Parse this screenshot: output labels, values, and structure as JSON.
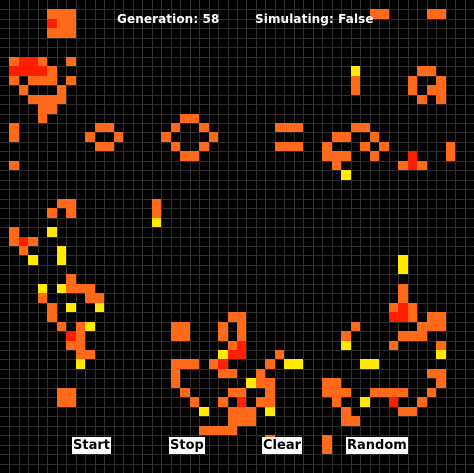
{
  "hud": {
    "generation_label": "Generation: 58",
    "simulating_label": "Simulating: False"
  },
  "controls": {
    "start_label": "Start",
    "stop_label": "Stop",
    "clear_label": "Clear",
    "random_label": "Random"
  },
  "grid": {
    "columns": 50,
    "rows": 50,
    "background_color": "#000000",
    "line_color": "#2e2e2e"
  },
  "colors": {
    "orange": "#ff6a1a",
    "red": "#ff1e00",
    "yellow": "#ffea00"
  },
  "live_cells": [
    {
      "c": 5,
      "r": 1,
      "k": "orange"
    },
    {
      "c": 6,
      "r": 1,
      "k": "orange"
    },
    {
      "c": 7,
      "r": 1,
      "k": "orange"
    },
    {
      "c": 5,
      "r": 2,
      "k": "red"
    },
    {
      "c": 6,
      "r": 2,
      "k": "orange"
    },
    {
      "c": 7,
      "r": 2,
      "k": "orange"
    },
    {
      "c": 5,
      "r": 3,
      "k": "orange"
    },
    {
      "c": 6,
      "r": 3,
      "k": "orange"
    },
    {
      "c": 7,
      "r": 3,
      "k": "orange"
    },
    {
      "c": 39,
      "r": 1,
      "k": "orange"
    },
    {
      "c": 40,
      "r": 1,
      "k": "orange"
    },
    {
      "c": 45,
      "r": 1,
      "k": "orange"
    },
    {
      "c": 46,
      "r": 1,
      "k": "orange"
    },
    {
      "c": 1,
      "r": 6,
      "k": "orange"
    },
    {
      "c": 2,
      "r": 6,
      "k": "red"
    },
    {
      "c": 3,
      "r": 6,
      "k": "red"
    },
    {
      "c": 4,
      "r": 6,
      "k": "orange"
    },
    {
      "c": 7,
      "r": 6,
      "k": "orange"
    },
    {
      "c": 1,
      "r": 7,
      "k": "red"
    },
    {
      "c": 2,
      "r": 7,
      "k": "red"
    },
    {
      "c": 3,
      "r": 7,
      "k": "red"
    },
    {
      "c": 4,
      "r": 7,
      "k": "red"
    },
    {
      "c": 5,
      "r": 7,
      "k": "orange"
    },
    {
      "c": 1,
      "r": 8,
      "k": "orange"
    },
    {
      "c": 3,
      "r": 8,
      "k": "orange"
    },
    {
      "c": 4,
      "r": 8,
      "k": "orange"
    },
    {
      "c": 5,
      "r": 8,
      "k": "orange"
    },
    {
      "c": 7,
      "r": 8,
      "k": "orange"
    },
    {
      "c": 2,
      "r": 9,
      "k": "orange"
    },
    {
      "c": 6,
      "r": 9,
      "k": "orange"
    },
    {
      "c": 3,
      "r": 10,
      "k": "orange"
    },
    {
      "c": 4,
      "r": 10,
      "k": "orange"
    },
    {
      "c": 5,
      "r": 10,
      "k": "orange"
    },
    {
      "c": 6,
      "r": 10,
      "k": "orange"
    },
    {
      "c": 4,
      "r": 11,
      "k": "orange"
    },
    {
      "c": 5,
      "r": 11,
      "k": "orange"
    },
    {
      "c": 4,
      "r": 12,
      "k": "orange"
    },
    {
      "c": 1,
      "r": 13,
      "k": "orange"
    },
    {
      "c": 1,
      "r": 14,
      "k": "orange"
    },
    {
      "c": 37,
      "r": 7,
      "k": "yellow"
    },
    {
      "c": 37,
      "r": 8,
      "k": "orange"
    },
    {
      "c": 37,
      "r": 9,
      "k": "orange"
    },
    {
      "c": 44,
      "r": 7,
      "k": "orange"
    },
    {
      "c": 45,
      "r": 7,
      "k": "orange"
    },
    {
      "c": 43,
      "r": 8,
      "k": "orange"
    },
    {
      "c": 46,
      "r": 8,
      "k": "orange"
    },
    {
      "c": 43,
      "r": 9,
      "k": "orange"
    },
    {
      "c": 45,
      "r": 9,
      "k": "orange"
    },
    {
      "c": 46,
      "r": 9,
      "k": "orange"
    },
    {
      "c": 44,
      "r": 10,
      "k": "orange"
    },
    {
      "c": 46,
      "r": 10,
      "k": "orange"
    },
    {
      "c": 10,
      "r": 13,
      "k": "orange"
    },
    {
      "c": 11,
      "r": 13,
      "k": "orange"
    },
    {
      "c": 9,
      "r": 14,
      "k": "orange"
    },
    {
      "c": 12,
      "r": 14,
      "k": "orange"
    },
    {
      "c": 10,
      "r": 15,
      "k": "orange"
    },
    {
      "c": 11,
      "r": 15,
      "k": "orange"
    },
    {
      "c": 19,
      "r": 12,
      "k": "orange"
    },
    {
      "c": 20,
      "r": 12,
      "k": "orange"
    },
    {
      "c": 18,
      "r": 13,
      "k": "orange"
    },
    {
      "c": 21,
      "r": 13,
      "k": "orange"
    },
    {
      "c": 17,
      "r": 14,
      "k": "orange"
    },
    {
      "c": 22,
      "r": 14,
      "k": "orange"
    },
    {
      "c": 18,
      "r": 15,
      "k": "orange"
    },
    {
      "c": 21,
      "r": 15,
      "k": "orange"
    },
    {
      "c": 19,
      "r": 16,
      "k": "orange"
    },
    {
      "c": 20,
      "r": 16,
      "k": "orange"
    },
    {
      "c": 29,
      "r": 13,
      "k": "orange"
    },
    {
      "c": 30,
      "r": 13,
      "k": "orange"
    },
    {
      "c": 31,
      "r": 13,
      "k": "orange"
    },
    {
      "c": 29,
      "r": 15,
      "k": "orange"
    },
    {
      "c": 30,
      "r": 15,
      "k": "orange"
    },
    {
      "c": 31,
      "r": 15,
      "k": "orange"
    },
    {
      "c": 37,
      "r": 13,
      "k": "orange"
    },
    {
      "c": 38,
      "r": 13,
      "k": "orange"
    },
    {
      "c": 35,
      "r": 14,
      "k": "orange"
    },
    {
      "c": 36,
      "r": 14,
      "k": "orange"
    },
    {
      "c": 39,
      "r": 14,
      "k": "orange"
    },
    {
      "c": 34,
      "r": 15,
      "k": "orange"
    },
    {
      "c": 38,
      "r": 15,
      "k": "orange"
    },
    {
      "c": 40,
      "r": 15,
      "k": "orange"
    },
    {
      "c": 47,
      "r": 15,
      "k": "orange"
    },
    {
      "c": 34,
      "r": 16,
      "k": "orange"
    },
    {
      "c": 35,
      "r": 16,
      "k": "orange"
    },
    {
      "c": 36,
      "r": 16,
      "k": "orange"
    },
    {
      "c": 39,
      "r": 16,
      "k": "orange"
    },
    {
      "c": 43,
      "r": 16,
      "k": "red"
    },
    {
      "c": 47,
      "r": 16,
      "k": "orange"
    },
    {
      "c": 35,
      "r": 17,
      "k": "orange"
    },
    {
      "c": 42,
      "r": 17,
      "k": "orange"
    },
    {
      "c": 43,
      "r": 17,
      "k": "red"
    },
    {
      "c": 44,
      "r": 17,
      "k": "orange"
    },
    {
      "c": 36,
      "r": 18,
      "k": "yellow"
    },
    {
      "c": 1,
      "r": 17,
      "k": "orange"
    },
    {
      "c": 6,
      "r": 21,
      "k": "orange"
    },
    {
      "c": 7,
      "r": 21,
      "k": "orange"
    },
    {
      "c": 5,
      "r": 22,
      "k": "orange"
    },
    {
      "c": 7,
      "r": 22,
      "k": "orange"
    },
    {
      "c": 16,
      "r": 21,
      "k": "orange"
    },
    {
      "c": 16,
      "r": 22,
      "k": "orange"
    },
    {
      "c": 16,
      "r": 23,
      "k": "yellow"
    },
    {
      "c": 1,
      "r": 24,
      "k": "orange"
    },
    {
      "c": 5,
      "r": 24,
      "k": "yellow"
    },
    {
      "c": 1,
      "r": 25,
      "k": "orange"
    },
    {
      "c": 2,
      "r": 25,
      "k": "red"
    },
    {
      "c": 3,
      "r": 25,
      "k": "orange"
    },
    {
      "c": 2,
      "r": 26,
      "k": "orange"
    },
    {
      "c": 6,
      "r": 26,
      "k": "yellow"
    },
    {
      "c": 3,
      "r": 27,
      "k": "yellow"
    },
    {
      "c": 6,
      "r": 27,
      "k": "yellow"
    },
    {
      "c": 7,
      "r": 29,
      "k": "orange"
    },
    {
      "c": 4,
      "r": 30,
      "k": "yellow"
    },
    {
      "c": 6,
      "r": 30,
      "k": "yellow"
    },
    {
      "c": 7,
      "r": 30,
      "k": "orange"
    },
    {
      "c": 8,
      "r": 30,
      "k": "orange"
    },
    {
      "c": 9,
      "r": 30,
      "k": "orange"
    },
    {
      "c": 4,
      "r": 31,
      "k": "orange"
    },
    {
      "c": 9,
      "r": 31,
      "k": "orange"
    },
    {
      "c": 10,
      "r": 31,
      "k": "orange"
    },
    {
      "c": 5,
      "r": 32,
      "k": "orange"
    },
    {
      "c": 7,
      "r": 32,
      "k": "yellow"
    },
    {
      "c": 10,
      "r": 32,
      "k": "yellow"
    },
    {
      "c": 5,
      "r": 33,
      "k": "orange"
    },
    {
      "c": 6,
      "r": 34,
      "k": "orange"
    },
    {
      "c": 8,
      "r": 34,
      "k": "orange"
    },
    {
      "c": 9,
      "r": 34,
      "k": "yellow"
    },
    {
      "c": 7,
      "r": 35,
      "k": "red"
    },
    {
      "c": 8,
      "r": 35,
      "k": "orange"
    },
    {
      "c": 7,
      "r": 36,
      "k": "orange"
    },
    {
      "c": 8,
      "r": 36,
      "k": "orange"
    },
    {
      "c": 8,
      "r": 37,
      "k": "orange"
    },
    {
      "c": 9,
      "r": 37,
      "k": "orange"
    },
    {
      "c": 8,
      "r": 38,
      "k": "yellow"
    },
    {
      "c": 6,
      "r": 41,
      "k": "orange"
    },
    {
      "c": 7,
      "r": 41,
      "k": "orange"
    },
    {
      "c": 6,
      "r": 42,
      "k": "orange"
    },
    {
      "c": 7,
      "r": 42,
      "k": "orange"
    },
    {
      "c": 18,
      "r": 34,
      "k": "orange"
    },
    {
      "c": 19,
      "r": 34,
      "k": "orange"
    },
    {
      "c": 18,
      "r": 35,
      "k": "orange"
    },
    {
      "c": 19,
      "r": 35,
      "k": "orange"
    },
    {
      "c": 24,
      "r": 33,
      "k": "orange"
    },
    {
      "c": 25,
      "r": 33,
      "k": "orange"
    },
    {
      "c": 23,
      "r": 34,
      "k": "orange"
    },
    {
      "c": 25,
      "r": 34,
      "k": "orange"
    },
    {
      "c": 23,
      "r": 35,
      "k": "orange"
    },
    {
      "c": 25,
      "r": 35,
      "k": "orange"
    },
    {
      "c": 24,
      "r": 36,
      "k": "orange"
    },
    {
      "c": 25,
      "r": 36,
      "k": "red"
    },
    {
      "c": 23,
      "r": 37,
      "k": "yellow"
    },
    {
      "c": 24,
      "r": 37,
      "k": "red"
    },
    {
      "c": 25,
      "r": 37,
      "k": "red"
    },
    {
      "c": 29,
      "r": 37,
      "k": "orange"
    },
    {
      "c": 18,
      "r": 38,
      "k": "orange"
    },
    {
      "c": 19,
      "r": 38,
      "k": "orange"
    },
    {
      "c": 20,
      "r": 38,
      "k": "orange"
    },
    {
      "c": 22,
      "r": 38,
      "k": "orange"
    },
    {
      "c": 23,
      "r": 38,
      "k": "red"
    },
    {
      "c": 28,
      "r": 38,
      "k": "orange"
    },
    {
      "c": 30,
      "r": 38,
      "k": "yellow"
    },
    {
      "c": 31,
      "r": 38,
      "k": "yellow"
    },
    {
      "c": 18,
      "r": 39,
      "k": "orange"
    },
    {
      "c": 23,
      "r": 39,
      "k": "orange"
    },
    {
      "c": 24,
      "r": 39,
      "k": "orange"
    },
    {
      "c": 27,
      "r": 39,
      "k": "orange"
    },
    {
      "c": 18,
      "r": 40,
      "k": "orange"
    },
    {
      "c": 26,
      "r": 40,
      "k": "yellow"
    },
    {
      "c": 27,
      "r": 40,
      "k": "orange"
    },
    {
      "c": 28,
      "r": 40,
      "k": "orange"
    },
    {
      "c": 19,
      "r": 41,
      "k": "orange"
    },
    {
      "c": 24,
      "r": 41,
      "k": "orange"
    },
    {
      "c": 25,
      "r": 41,
      "k": "orange"
    },
    {
      "c": 28,
      "r": 41,
      "k": "orange"
    },
    {
      "c": 20,
      "r": 42,
      "k": "orange"
    },
    {
      "c": 23,
      "r": 42,
      "k": "orange"
    },
    {
      "c": 25,
      "r": 42,
      "k": "red"
    },
    {
      "c": 27,
      "r": 42,
      "k": "orange"
    },
    {
      "c": 28,
      "r": 42,
      "k": "orange"
    },
    {
      "c": 21,
      "r": 43,
      "k": "yellow"
    },
    {
      "c": 24,
      "r": 43,
      "k": "orange"
    },
    {
      "c": 25,
      "r": 43,
      "k": "orange"
    },
    {
      "c": 26,
      "r": 43,
      "k": "orange"
    },
    {
      "c": 28,
      "r": 43,
      "k": "yellow"
    },
    {
      "c": 24,
      "r": 44,
      "k": "orange"
    },
    {
      "c": 25,
      "r": 44,
      "k": "orange"
    },
    {
      "c": 26,
      "r": 44,
      "k": "orange"
    },
    {
      "c": 21,
      "r": 45,
      "k": "orange"
    },
    {
      "c": 22,
      "r": 45,
      "k": "orange"
    },
    {
      "c": 23,
      "r": 45,
      "k": "orange"
    },
    {
      "c": 24,
      "r": 45,
      "k": "orange"
    },
    {
      "c": 28,
      "r": 46,
      "k": "orange"
    },
    {
      "c": 34,
      "r": 46,
      "k": "orange"
    },
    {
      "c": 34,
      "r": 47,
      "k": "orange"
    },
    {
      "c": 42,
      "r": 27,
      "k": "yellow"
    },
    {
      "c": 42,
      "r": 28,
      "k": "yellow"
    },
    {
      "c": 42,
      "r": 30,
      "k": "orange"
    },
    {
      "c": 42,
      "r": 31,
      "k": "orange"
    },
    {
      "c": 41,
      "r": 32,
      "k": "orange"
    },
    {
      "c": 42,
      "r": 32,
      "k": "red"
    },
    {
      "c": 43,
      "r": 32,
      "k": "orange"
    },
    {
      "c": 41,
      "r": 33,
      "k": "red"
    },
    {
      "c": 42,
      "r": 33,
      "k": "red"
    },
    {
      "c": 43,
      "r": 33,
      "k": "orange"
    },
    {
      "c": 45,
      "r": 33,
      "k": "orange"
    },
    {
      "c": 46,
      "r": 33,
      "k": "orange"
    },
    {
      "c": 37,
      "r": 34,
      "k": "orange"
    },
    {
      "c": 44,
      "r": 34,
      "k": "orange"
    },
    {
      "c": 45,
      "r": 34,
      "k": "orange"
    },
    {
      "c": 46,
      "r": 34,
      "k": "orange"
    },
    {
      "c": 36,
      "r": 35,
      "k": "orange"
    },
    {
      "c": 42,
      "r": 35,
      "k": "orange"
    },
    {
      "c": 43,
      "r": 35,
      "k": "orange"
    },
    {
      "c": 44,
      "r": 35,
      "k": "orange"
    },
    {
      "c": 36,
      "r": 36,
      "k": "yellow"
    },
    {
      "c": 41,
      "r": 36,
      "k": "orange"
    },
    {
      "c": 46,
      "r": 36,
      "k": "orange"
    },
    {
      "c": 46,
      "r": 37,
      "k": "yellow"
    },
    {
      "c": 38,
      "r": 38,
      "k": "yellow"
    },
    {
      "c": 39,
      "r": 38,
      "k": "yellow"
    },
    {
      "c": 45,
      "r": 39,
      "k": "orange"
    },
    {
      "c": 46,
      "r": 39,
      "k": "orange"
    },
    {
      "c": 34,
      "r": 40,
      "k": "orange"
    },
    {
      "c": 35,
      "r": 40,
      "k": "orange"
    },
    {
      "c": 46,
      "r": 40,
      "k": "orange"
    },
    {
      "c": 34,
      "r": 41,
      "k": "orange"
    },
    {
      "c": 35,
      "r": 41,
      "k": "orange"
    },
    {
      "c": 36,
      "r": 41,
      "k": "orange"
    },
    {
      "c": 39,
      "r": 41,
      "k": "orange"
    },
    {
      "c": 40,
      "r": 41,
      "k": "orange"
    },
    {
      "c": 41,
      "r": 41,
      "k": "orange"
    },
    {
      "c": 42,
      "r": 41,
      "k": "orange"
    },
    {
      "c": 45,
      "r": 41,
      "k": "orange"
    },
    {
      "c": 35,
      "r": 42,
      "k": "orange"
    },
    {
      "c": 38,
      "r": 42,
      "k": "yellow"
    },
    {
      "c": 41,
      "r": 42,
      "k": "red"
    },
    {
      "c": 44,
      "r": 42,
      "k": "orange"
    },
    {
      "c": 36,
      "r": 43,
      "k": "orange"
    },
    {
      "c": 42,
      "r": 43,
      "k": "orange"
    },
    {
      "c": 43,
      "r": 43,
      "k": "orange"
    },
    {
      "c": 36,
      "r": 44,
      "k": "orange"
    },
    {
      "c": 37,
      "r": 44,
      "k": "orange"
    }
  ]
}
